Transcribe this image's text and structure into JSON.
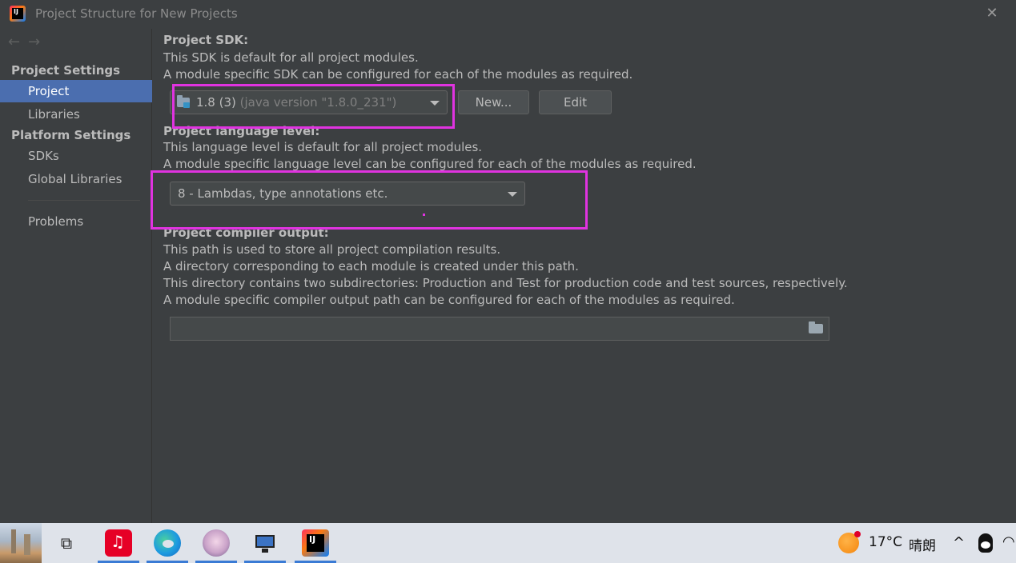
{
  "window": {
    "title": "Project Structure for New Projects",
    "close_glyph": "✕",
    "back_glyph": "←",
    "forward_glyph": "→"
  },
  "sidebar": {
    "project_settings_header": "Project Settings",
    "platform_settings_header": "Platform Settings",
    "items": [
      {
        "label": "Project",
        "selected": true
      },
      {
        "label": "Libraries",
        "selected": false
      },
      {
        "label": "SDKs",
        "selected": false
      },
      {
        "label": "Global Libraries",
        "selected": false
      },
      {
        "label": "Problems",
        "selected": false
      }
    ]
  },
  "sdk": {
    "title": "Project SDK:",
    "desc1": "This SDK is default for all project modules.",
    "desc2": "A module specific SDK can be configured for each of the modules as required.",
    "selected_name": "1.8 (3)",
    "selected_detail": "(java version \"1.8.0_231\")",
    "new_button": "New...",
    "edit_button": "Edit"
  },
  "language": {
    "title": "Project language level:",
    "desc1": "This language level is default for all project modules.",
    "desc2": "A module specific language level can be configured for each of the modules as required.",
    "selected": "8 - Lambdas, type annotations etc."
  },
  "compiler": {
    "title": "Project compiler output:",
    "desc1": "This path is used to store all project compilation results.",
    "desc2": "A directory corresponding to each module is created under this path.",
    "desc3": "This directory contains two subdirectories: Production and Test for production code and test sources, respectively.",
    "desc4": "A module specific compiler output path can be configured for each of the modules as required.",
    "path_value": ""
  },
  "taskbar": {
    "temperature": "17°C",
    "weather": "晴朗",
    "tray_arrow": "^",
    "taskview_glyph": "⧉",
    "netease_glyph": "♫",
    "ij_label": "IJ",
    "icons": [
      "start-wallpaper-icon",
      "task-view-icon",
      "netease-music-icon",
      "edge-icon",
      "avatar-app-icon",
      "monitor-app-icon",
      "intellij-icon",
      "weather-icon",
      "qq-icon",
      "wifi-icon"
    ]
  },
  "colors": {
    "background": "#3c3f41",
    "selection": "#4b6eaf",
    "highlight": "#e033e0",
    "taskbar": "#dfe3ea"
  }
}
